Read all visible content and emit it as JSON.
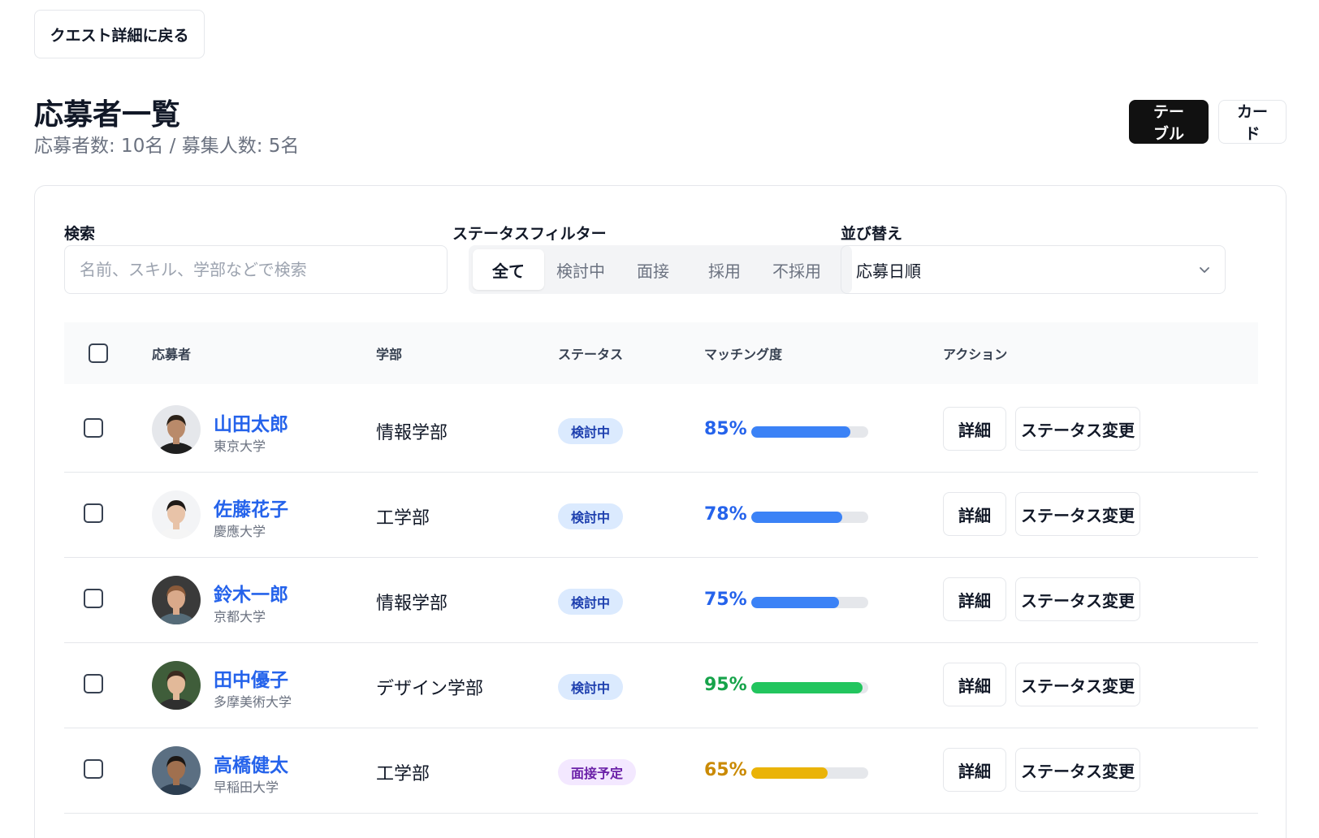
{
  "back_button": "クエスト詳細に戻る",
  "header": {
    "title": "応募者一覧",
    "subtitle": "応募者数: 10名 / 募集人数: 5名"
  },
  "view_toggle": {
    "table": "テーブル",
    "card": "カード",
    "selected": "テーブル"
  },
  "filters": {
    "search_label": "検索",
    "search_placeholder": "名前、スキル、学部などで検索",
    "search_value": "",
    "status_label": "ステータスフィルター",
    "status_options": [
      "全て",
      "検討中",
      "面接",
      "採用",
      "不採用"
    ],
    "status_selected": "全て",
    "sort_label": "並び替え",
    "sort_value": "応募日順"
  },
  "table": {
    "headers": {
      "applicant": "応募者",
      "department": "学部",
      "status": "ステータス",
      "matching": "マッチング度",
      "actions": "アクション"
    },
    "detail_label": "詳細",
    "status_change_label": "ステータス変更",
    "rows": [
      {
        "name": "山田太郎",
        "university": "東京大学",
        "department": "情報学部",
        "status": "検討中",
        "matching_pct": "85%",
        "matching": 0.85,
        "bar_color": "#3b82f6",
        "pct_color": "#2563eb",
        "badge_bg": "#dbeafe",
        "badge_fg": "#1e40af",
        "avatar_bg": "#e5e7eb",
        "avatar_skin": "#b98a6a",
        "avatar_hair": "#2b2118",
        "avatar_shirt": "#1f1f1f"
      },
      {
        "name": "佐藤花子",
        "university": "慶應大学",
        "department": "工学部",
        "status": "検討中",
        "matching_pct": "78%",
        "matching": 0.78,
        "bar_color": "#3b82f6",
        "pct_color": "#2563eb",
        "badge_bg": "#dbeafe",
        "badge_fg": "#1e40af",
        "avatar_bg": "#f3f4f6",
        "avatar_skin": "#e8c3a8",
        "avatar_hair": "#1f1a17",
        "avatar_shirt": "#f5f5f5"
      },
      {
        "name": "鈴木一郎",
        "university": "京都大学",
        "department": "情報学部",
        "status": "検討中",
        "matching_pct": "75%",
        "matching": 0.75,
        "bar_color": "#3b82f6",
        "pct_color": "#2563eb",
        "badge_bg": "#dbeafe",
        "badge_fg": "#1e40af",
        "avatar_bg": "#3a3a3a",
        "avatar_skin": "#d9a98a",
        "avatar_hair": "#8a5a3a",
        "avatar_shirt": "#556b78"
      },
      {
        "name": "田中優子",
        "university": "多摩美術大学",
        "department": "デザイン学部",
        "status": "検討中",
        "matching_pct": "95%",
        "matching": 0.95,
        "bar_color": "#22c55e",
        "pct_color": "#16a34a",
        "badge_bg": "#dbeafe",
        "badge_fg": "#1e40af",
        "avatar_bg": "#3f5d3a",
        "avatar_skin": "#e2b999",
        "avatar_hair": "#3b2a1f",
        "avatar_shirt": "#2f2f2f"
      },
      {
        "name": "高橋健太",
        "university": "早稲田大学",
        "department": "工学部",
        "status": "面接予定",
        "matching_pct": "65%",
        "matching": 0.65,
        "bar_color": "#eab308",
        "pct_color": "#ca8a04",
        "badge_bg": "#f3e8ff",
        "badge_fg": "#6b21a8",
        "avatar_bg": "#5b6f82",
        "avatar_skin": "#a0704f",
        "avatar_hair": "#1c1714",
        "avatar_shirt": "#2d3e50"
      }
    ]
  }
}
